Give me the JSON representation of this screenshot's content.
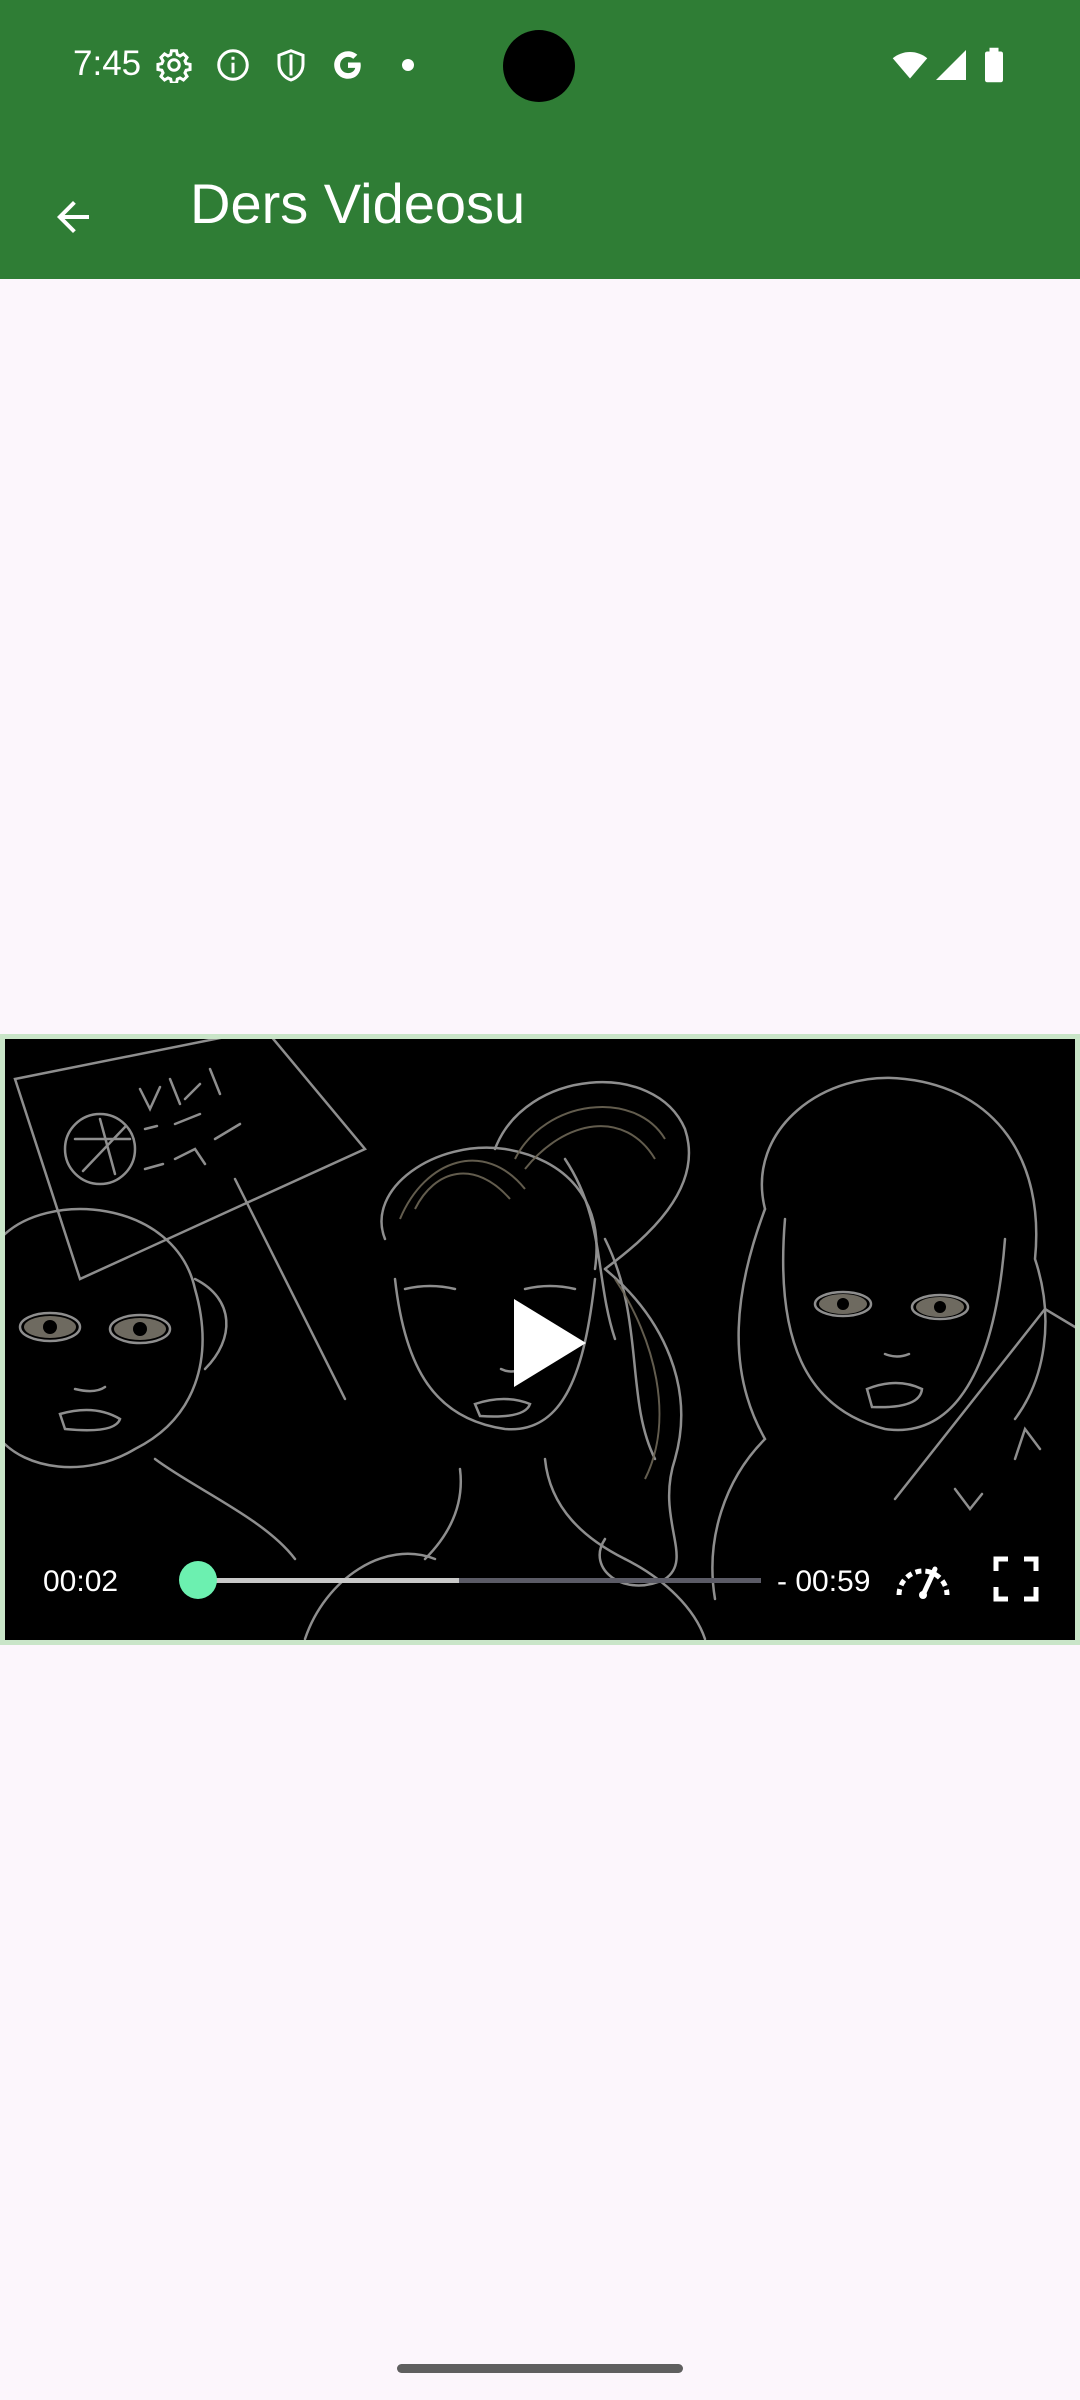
{
  "status_bar": {
    "time": "7:45",
    "icons": [
      "gear-icon",
      "info-icon",
      "shield-icon",
      "google-g-icon",
      "dot-icon",
      "wifi-icon",
      "signal-icon",
      "battery-icon"
    ]
  },
  "app_bar": {
    "title": "Ders Videosu",
    "back_icon": "arrow-back-icon",
    "color": "#2F7D35"
  },
  "video_player": {
    "current_time": "00:02",
    "remaining_time": "- 00:59",
    "progress": 0.03,
    "buffered": 0.48,
    "play_icon": "play-icon",
    "speed_icon": "speedometer-icon",
    "fullscreen_icon": "fullscreen-icon",
    "accent_color": "#6CF0B0"
  },
  "colors": {
    "background": "#FCF6FC",
    "video_border": "#C9E5C8"
  }
}
